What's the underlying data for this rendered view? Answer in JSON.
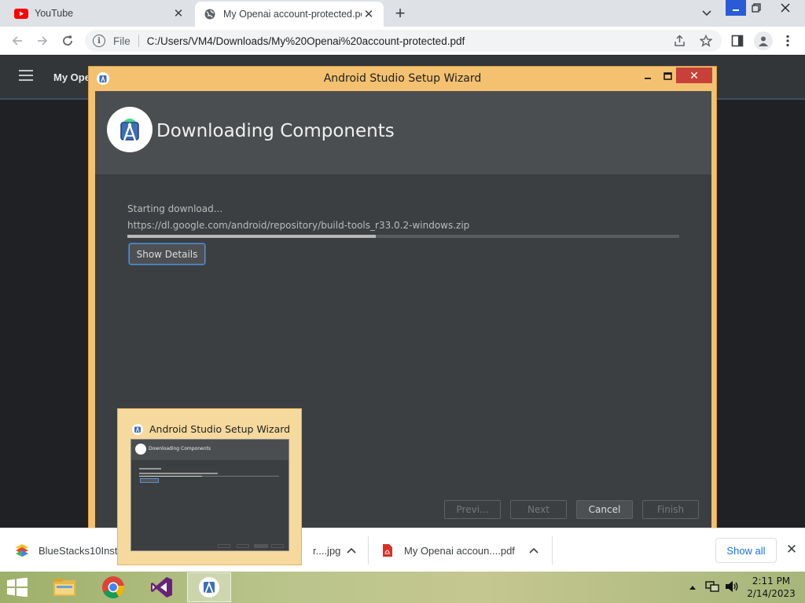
{
  "browser": {
    "tabs": [
      {
        "title": "YouTube",
        "icon": "youtube-icon",
        "active": false
      },
      {
        "title": "My Openai account-protected.pc",
        "icon": "globe-icon",
        "active": true
      }
    ],
    "omnibox": {
      "scheme": "File",
      "url": "C:/Users/VM4/Downloads/My%20Openai%20account-protected.pdf"
    },
    "pdf_title": "My Ope"
  },
  "wizard": {
    "title": "Android Studio Setup Wizard",
    "heading": "Downloading Components",
    "status": "Starting download...",
    "url": "https://dl.google.com/android/repository/build-tools_r33.0.2-windows.zip",
    "progress": 0.45,
    "show_details_label": "Show Details",
    "buttons": {
      "prev": "Previ...",
      "next": "Next",
      "cancel": "Cancel",
      "finish": "Finish"
    }
  },
  "preview": {
    "title": "Android Studio Setup Wizard",
    "thumb_heading": "Downloading Components"
  },
  "downloads": {
    "items": [
      {
        "name": "BlueStacks10Insta"
      },
      {
        "name": "r....jpg"
      },
      {
        "name": "My Openai accoun....pdf"
      }
    ],
    "show_all": "Show all"
  },
  "taskbar": {
    "time": "2:11 PM",
    "date": "2/14/2023"
  },
  "colors": {
    "wizard_frame": "#f3c170",
    "wizard_bg": "#3c3f41",
    "close_red": "#c7413a",
    "link_blue": "#1a73e8"
  }
}
